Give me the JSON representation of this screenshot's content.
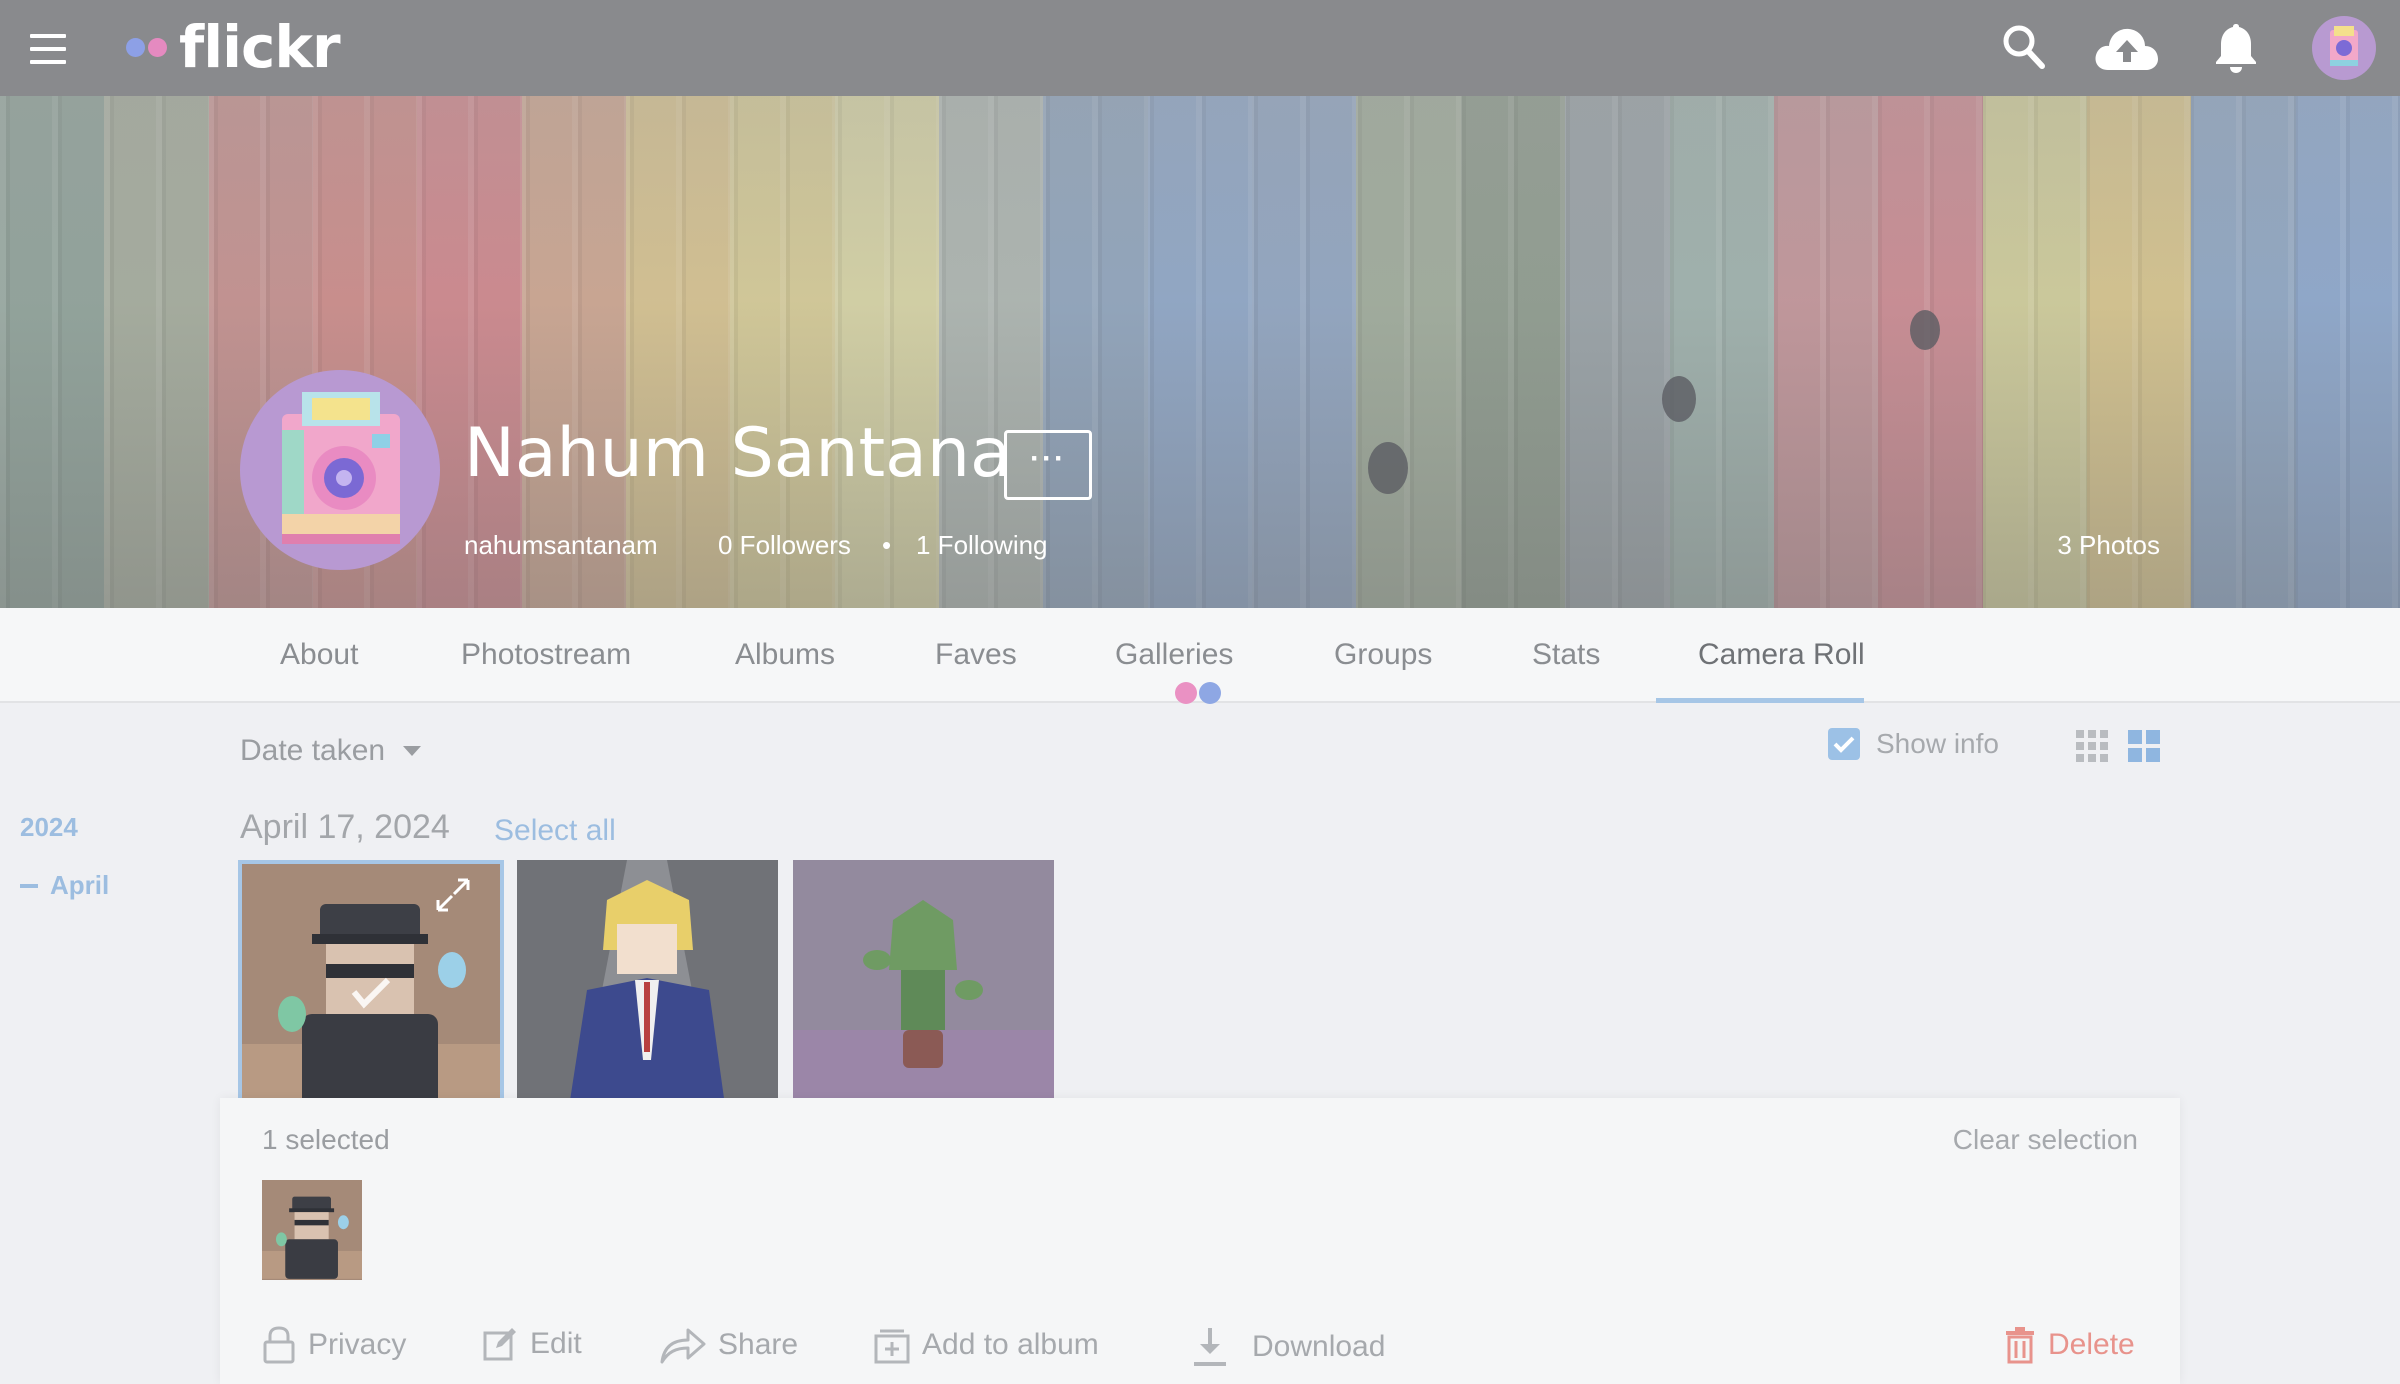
{
  "app": {
    "logo_text": "flickr",
    "accent": "#a6c6e6"
  },
  "topbar": {
    "icons": [
      "menu-icon",
      "search-icon",
      "upload-cloud-icon",
      "notification-bell-icon",
      "user-avatar"
    ]
  },
  "profile": {
    "name": "Nahum Santana",
    "more_label": "···",
    "username": "nahumsantanam",
    "followers": "0 Followers",
    "separator": "•",
    "following": "1 Following",
    "photos_count": "3 Photos"
  },
  "tabs": [
    {
      "label": "About"
    },
    {
      "label": "Photostream"
    },
    {
      "label": "Albums"
    },
    {
      "label": "Faves"
    },
    {
      "label": "Galleries"
    },
    {
      "label": "Groups"
    },
    {
      "label": "Stats"
    },
    {
      "label": "Camera Roll",
      "active": true
    }
  ],
  "controls": {
    "sort_label": "Date taken",
    "show_info_label": "Show info",
    "show_info_checked": true
  },
  "timeline": {
    "year": "2024",
    "month": "April"
  },
  "group": {
    "date": "April 17, 2024",
    "select_all": "Select all"
  },
  "photos": [
    {
      "alt": "pixel character in cap with spirit flames",
      "selected": true
    },
    {
      "alt": "pixel blonde character in suit"
    },
    {
      "alt": "pixel green plant creature in pot"
    }
  ],
  "selection": {
    "count_label": "1 selected",
    "clear_label": "Clear selection",
    "actions": {
      "privacy": "Privacy",
      "edit": "Edit",
      "share": "Share",
      "add_to_album": "Add to album",
      "download": "Download",
      "delete": "Delete"
    }
  }
}
